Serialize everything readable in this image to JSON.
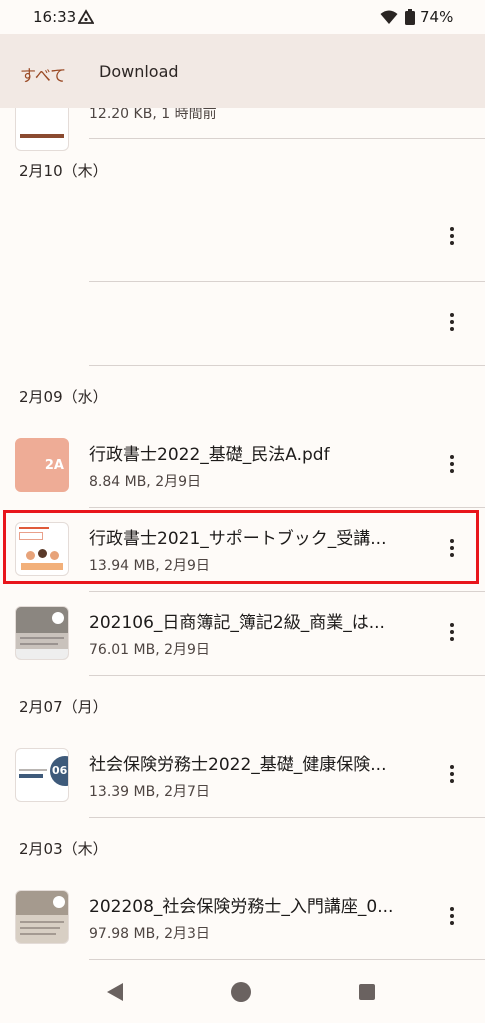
{
  "status_bar": {
    "time": "16:33",
    "battery": "74%"
  },
  "header": {
    "tabs": [
      {
        "label": "すべて"
      },
      {
        "label": "Download"
      }
    ]
  },
  "partial_item": {
    "meta": "12.20 KB, 1 時間前"
  },
  "sections": [
    {
      "date": "2月10（木）",
      "items": [
        {
          "title": "",
          "meta": ""
        },
        {
          "title": "",
          "meta": ""
        }
      ]
    },
    {
      "date": "2月09（水）",
      "items": [
        {
          "title": "行政書士2022_基礎_民法A.pdf",
          "meta": "8.84 MB, 2月9日",
          "thumb_label": "2A"
        },
        {
          "title": "行政書士2021_サポートブック_受講...",
          "meta": "13.94 MB, 2月9日"
        },
        {
          "title": "202106_日商簿記_簿記2級_商業_は...",
          "meta": "76.01 MB, 2月9日"
        }
      ]
    },
    {
      "date": "2月07（月）",
      "items": [
        {
          "title": "社会保険労務士2022_基礎_健康保険...",
          "meta": "13.39 MB, 2月7日",
          "thumb_label": "06"
        }
      ]
    },
    {
      "date": "2月03（木）",
      "items": [
        {
          "title": "202208_社会保険労務士_入門講座_0...",
          "meta": "97.98 MB, 2月3日"
        }
      ]
    }
  ],
  "colors": {
    "accent": "#9a4a25",
    "highlight": "#e8151b",
    "thumb_salmon": "#eeac96",
    "badge_navy": "#3e5a7a"
  }
}
